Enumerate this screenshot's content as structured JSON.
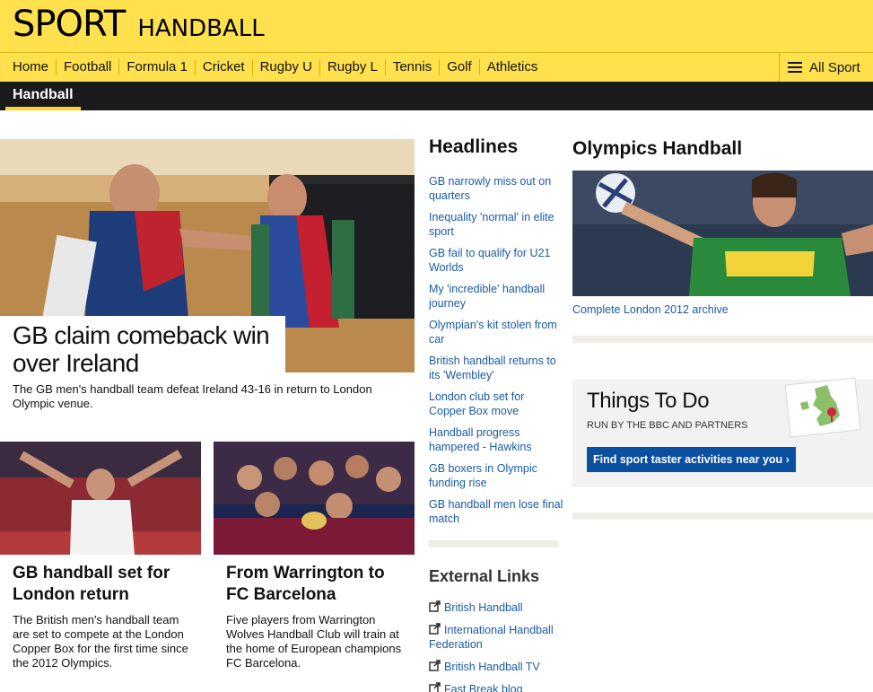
{
  "brand": {
    "sport": "SPORT",
    "section": "HANDBALL"
  },
  "nav": {
    "items": [
      "Home",
      "Football",
      "Formula 1",
      "Cricket",
      "Rugby U",
      "Rugby L",
      "Tennis",
      "Golf",
      "Athletics"
    ],
    "all_sport": "All Sport"
  },
  "subnav": {
    "active": "Handball"
  },
  "main_story": {
    "headline": "GB claim comeback win over Ireland",
    "summary": "The GB men's handball team defeat Ireland 43-16 in return to London Olympic venue."
  },
  "stories": [
    {
      "title": "GB handball set for London return",
      "summary": "The British men's handball team are set to compete at the London Copper Box for the first time since the 2012 Olympics."
    },
    {
      "title": "From Warrington to FC Barcelona",
      "summary": "Five players from Warrington Wolves Handball Club will train at the home of European champions FC Barcelona."
    }
  ],
  "headlines": {
    "title": "Headlines",
    "items": [
      "GB narrowly miss out on quarters",
      "Inequality 'normal' in elite sport",
      "GB fail to qualify for U21 Worlds",
      "My 'incredible' handball journey",
      "Olympian's kit stolen from car",
      "British handball returns to its 'Wembley'",
      "London club set for Copper Box move",
      "Handball progress hampered - Hawkins",
      "GB boxers in Olympic funding rise",
      "GB handball men lose final match"
    ]
  },
  "external_links": {
    "title": "External Links",
    "items": [
      "British Handball",
      "International Handball Federation",
      "British Handball TV",
      "Fast Break blog"
    ]
  },
  "olympics": {
    "title": "Olympics Handball",
    "archive_link": "Complete London 2012 archive"
  },
  "things_to_do": {
    "title": "Things To Do",
    "subtitle": "RUN BY THE BBC AND PARTNERS",
    "button": "Find sport taster activities near you ›"
  },
  "colors": {
    "brand_yellow": "#ffe14d",
    "link_blue": "#1a5aa6",
    "button_blue": "#0a4fa0",
    "subnav_black": "#1a1a1a"
  }
}
